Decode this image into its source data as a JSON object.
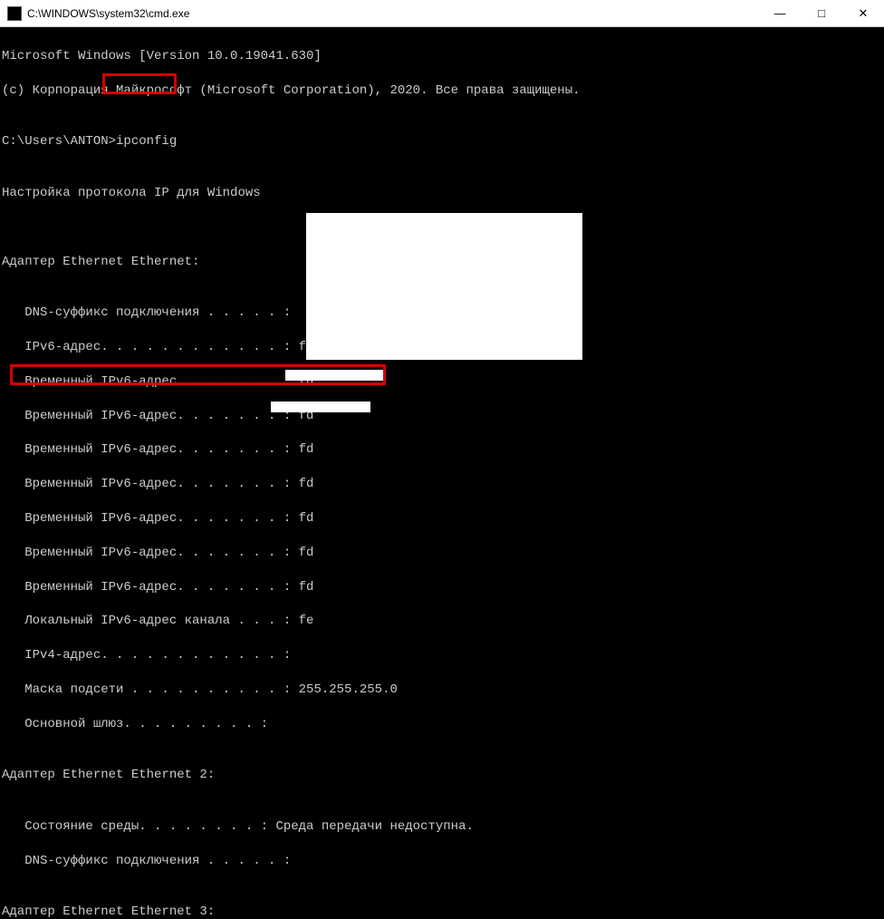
{
  "titlebar": {
    "path": "C:\\WINDOWS\\system32\\cmd.exe",
    "min": "—",
    "max": "□",
    "close": "✕"
  },
  "lines": {
    "l0": "Microsoft Windows [Version 10.0.19041.630]",
    "l1": "(c) Корпорация Майкрософт (Microsoft Corporation), 2020. Все права защищены.",
    "l2": "",
    "l3": "C:\\Users\\ANTON>ipconfig",
    "l4": "",
    "l5": "Настройка протокола IP для Windows",
    "l6": "",
    "l7": "",
    "l8": "Адаптер Ethernet Ethernet:",
    "l9": "",
    "l10": "   DNS-суффикс подключения . . . . . :",
    "l11": "   IPv6-адрес. . . . . . . . . . . . : fd",
    "l12": "   Временный IPv6-адрес. . . . . . . : fd",
    "l13": "   Временный IPv6-адрес. . . . . . . : fd",
    "l14": "   Временный IPv6-адрес. . . . . . . : fd",
    "l15": "   Временный IPv6-адрес. . . . . . . : fd",
    "l16": "   Временный IPv6-адрес. . . . . . . : fd",
    "l17": "   Временный IPv6-адрес. . . . . . . : fd",
    "l18": "   Временный IPv6-адрес. . . . . . . : fd",
    "l19": "   Локальный IPv6-адрес канала . . . : fe",
    "l20": "   IPv4-адрес. . . . . . . . . . . . :",
    "l21": "   Маска подсети . . . . . . . . . . : 255.255.255.0",
    "l22": "   Основной шлюз. . . . . . . . . :",
    "l23": "",
    "l24": "Адаптер Ethernet Ethernet 2:",
    "l25": "",
    "l26": "   Состояние среды. . . . . . . . : Среда передачи недоступна.",
    "l27": "   DNS-суффикс подключения . . . . . :",
    "l28": "",
    "l29": "Адаптер Ethernet Ethernet 3:"
  }
}
